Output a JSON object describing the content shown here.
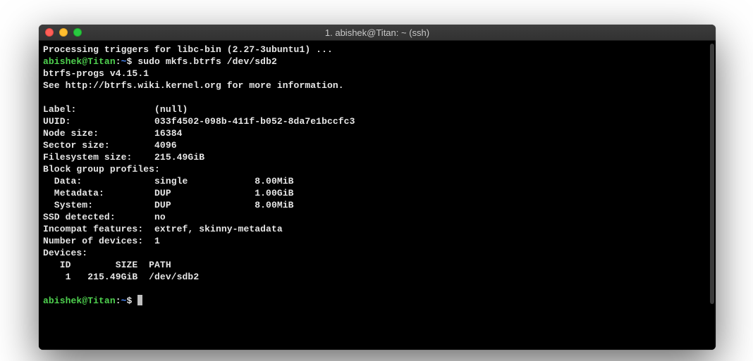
{
  "window": {
    "title": "1. abishek@Titan: ~ (ssh)"
  },
  "prompt": {
    "user_host": "abishek@Titan",
    "colon": ":",
    "path": "~",
    "symbol": "$"
  },
  "lines": {
    "l0": "Processing triggers for libc-bin (2.27-3ubuntu1) ...",
    "cmd1": " sudo mkfs.btrfs /dev/sdb2",
    "l2": "btrfs-progs v4.15.1",
    "l3": "See http://btrfs.wiki.kernel.org for more information.",
    "l4": "",
    "l5": "Label:              (null)",
    "l6": "UUID:               033f4502-098b-411f-b052-8da7e1bccfc3",
    "l7": "Node size:          16384",
    "l8": "Sector size:        4096",
    "l9": "Filesystem size:    215.49GiB",
    "l10": "Block group profiles:",
    "l11": "  Data:             single            8.00MiB",
    "l12": "  Metadata:         DUP               1.00GiB",
    "l13": "  System:           DUP               8.00MiB",
    "l14": "SSD detected:       no",
    "l15": "Incompat features:  extref, skinny-metadata",
    "l16": "Number of devices:  1",
    "l17": "Devices:",
    "l18": "   ID        SIZE  PATH",
    "l19": "    1   215.49GiB  /dev/sdb2",
    "l20": ""
  }
}
